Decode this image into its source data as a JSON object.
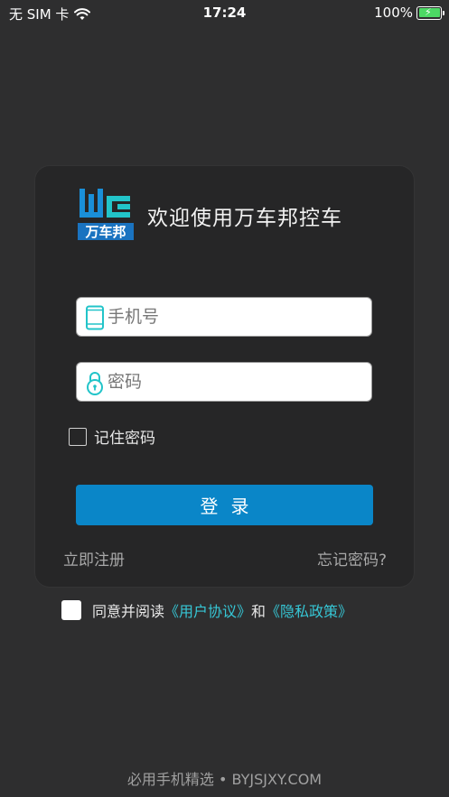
{
  "status_bar": {
    "carrier": "无 SIM 卡",
    "time": "17:24",
    "battery_percent": "100%",
    "battery_level": 1.0,
    "battery_color": "#4cd964"
  },
  "app": {
    "logo_text": "万车邦",
    "welcome": "欢迎使用万车邦控车"
  },
  "form": {
    "phone_placeholder": "手机号",
    "password_placeholder": "密码",
    "remember_label": "记住密码",
    "login_label": "登录",
    "register_label": "立即注册",
    "forgot_label": "忘记密码?"
  },
  "agreement": {
    "prefix": "同意并阅读",
    "user_agreement": "《用户协议》",
    "conjunction": "和",
    "privacy_policy": "《隐私政策》"
  },
  "footer": {
    "watermark": "必用手机精选 • BYJSJXY.COM"
  },
  "colors": {
    "background": "#2e2e2f",
    "card": "#262627",
    "primary_button": "#0a86c8",
    "link": "#36c7d6",
    "icon_accent": "#22c4c9"
  },
  "icons": [
    "wifi-icon",
    "battery-icon",
    "phone-icon",
    "lock-icon",
    "app-logo"
  ]
}
